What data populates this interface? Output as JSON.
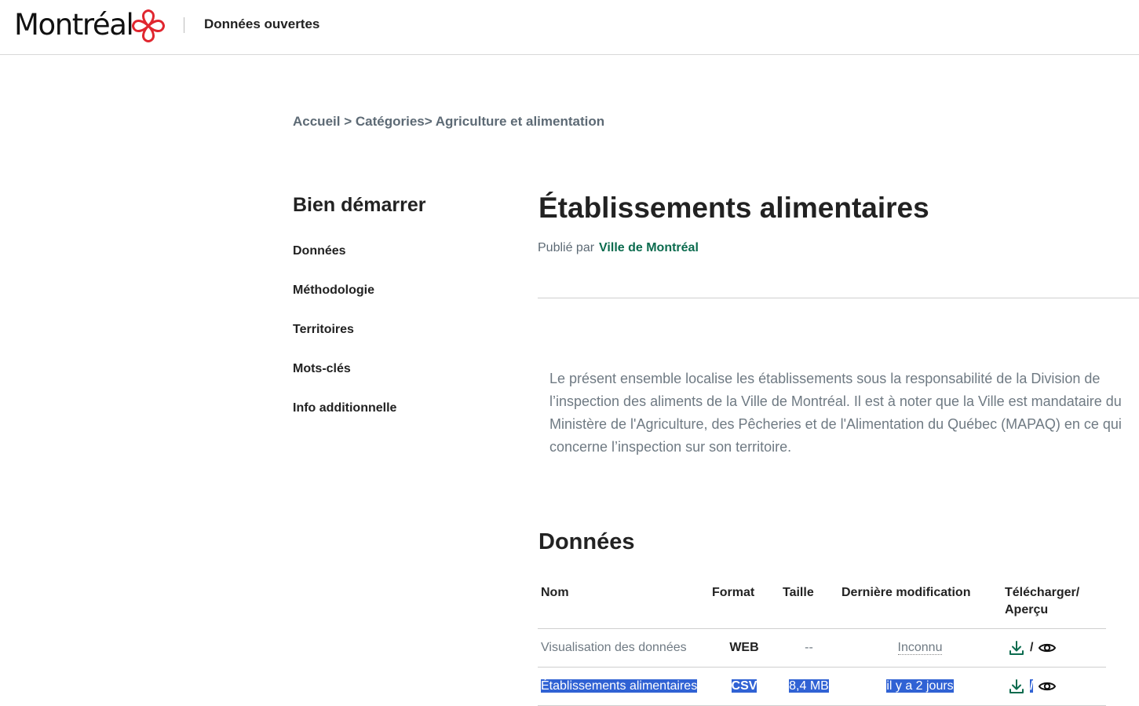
{
  "header": {
    "logo_text": "Montréal",
    "site_name": "Données ouvertes"
  },
  "breadcrumb": {
    "home": "Accueil",
    "sep1": " > ",
    "categories": "Catégories",
    "sep2": "> ",
    "current": "Agriculture et alimentation"
  },
  "sidebar": {
    "title": "Bien démarrer",
    "items": [
      {
        "label": "Données"
      },
      {
        "label": "Méthodologie"
      },
      {
        "label": "Territoires"
      },
      {
        "label": "Mots-clés"
      },
      {
        "label": "Info additionnelle"
      }
    ]
  },
  "main": {
    "title": "Établissements alimentaires",
    "published_by_label": "Publié par",
    "publisher": "Ville de Montréal",
    "description": "Le présent ensemble localise les établissements sous la responsabilité de la Division de l’inspection des aliments de la Ville de Montréal. Il est à noter que la Ville est mandataire du Ministère de l'Agriculture, des Pêcheries et de l'Alimentation du Québec (MAPAQ) en ce qui concerne l’inspection sur son territoire."
  },
  "data_section": {
    "title": "Données",
    "columns": {
      "name": "Nom",
      "format": "Format",
      "size": "Taille",
      "modified": "Dernière modification",
      "download_line1": "Télécharger/",
      "download_line2": "Aperçu"
    },
    "rows": [
      {
        "name": "Visualisation des données",
        "format": "WEB",
        "size": "--",
        "modified": "Inconnu",
        "slash": "/"
      },
      {
        "name": "Établissements alimentaires",
        "format": "CSV",
        "size": "8,4 MB",
        "modified": "il y a 2 jours",
        "slash": "/"
      }
    ]
  },
  "icons": {
    "logo": "montreal-rosette-icon",
    "download": "download-icon",
    "preview": "eye-icon"
  },
  "colors": {
    "brand_red": "#e0262f",
    "link_green": "#0b6b4e",
    "selection_blue": "#3062d4"
  }
}
